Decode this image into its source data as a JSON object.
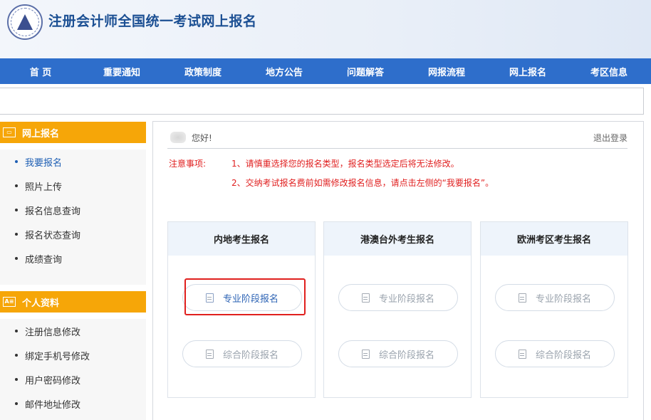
{
  "header": {
    "title": "注册会计师全国统一考试网上报名"
  },
  "nav": [
    {
      "label": "首 页"
    },
    {
      "label": "重要通知"
    },
    {
      "label": "政策制度"
    },
    {
      "label": "地方公告"
    },
    {
      "label": "问题解答"
    },
    {
      "label": "网报流程"
    },
    {
      "label": "网上报名"
    },
    {
      "label": "考区信息"
    }
  ],
  "sidebar": {
    "section1": {
      "title": "网上报名",
      "items": [
        {
          "label": "我要报名",
          "active": true
        },
        {
          "label": "照片上传"
        },
        {
          "label": "报名信息查询"
        },
        {
          "label": "报名状态查询"
        },
        {
          "label": "成绩查询"
        }
      ]
    },
    "section2": {
      "title": "个人资料",
      "items": [
        {
          "label": "注册信息修改"
        },
        {
          "label": "绑定手机号修改"
        },
        {
          "label": "用户密码修改"
        },
        {
          "label": "邮件地址修改"
        }
      ]
    }
  },
  "main": {
    "greeting": "您好!",
    "logout": "退出登录",
    "notice_label": "注意事项:",
    "notices": [
      "1、请慎重选择您的报名类型，报名类型选定后将无法修改。",
      "2、交纳考试报名费前如需修改报名信息，请点击左侧的“我要报名”。"
    ],
    "cards": [
      {
        "title": "内地考生报名",
        "btn1": "专业阶段报名",
        "btn2": "综合阶段报名"
      },
      {
        "title": "港澳台外考生报名",
        "btn1": "专业阶段报名",
        "btn2": "综合阶段报名"
      },
      {
        "title": "欧洲考区考生报名",
        "btn1": "专业阶段报名",
        "btn2": "综合阶段报名"
      }
    ]
  },
  "colors": {
    "nav_bg": "#2e6ecb",
    "sidebar_head": "#f6a608",
    "title": "#1b4f93",
    "notice_red": "#e02020",
    "highlight": "#e0201e"
  }
}
